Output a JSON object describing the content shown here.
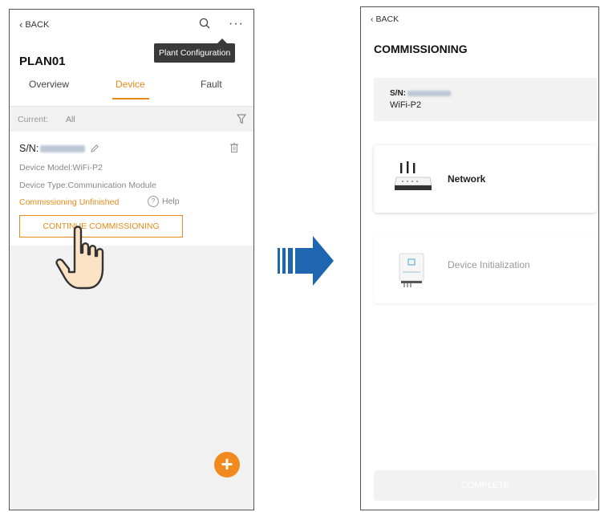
{
  "left": {
    "back_label": "BACK",
    "tooltip": "Plant Configuration",
    "plan_name": "PLAN01",
    "tabs": [
      {
        "label": "Overview"
      },
      {
        "label": "Device"
      },
      {
        "label": "Fault"
      }
    ],
    "active_tab": "Device",
    "filter": {
      "current_label": "Current:",
      "current_value": "All"
    },
    "device": {
      "sn_label": "S/N:",
      "model": "Device Model:WiFi-P2",
      "type": "Device Type:Communication Module",
      "status": "Commissioning Unfinished",
      "help_label": "Help",
      "help_glyph": "?",
      "continue_button": "CONTINUE COMMISSIONING"
    },
    "fab_glyph": "+"
  },
  "right": {
    "back_label": "BACK",
    "title": "COMMISSIONING",
    "sn_label": "S/N:",
    "device_name": "WiFi-P2",
    "options": [
      {
        "label": "Network"
      },
      {
        "label": "Device Initialization"
      }
    ],
    "complete_button": "COMPLETE"
  },
  "colors": {
    "accent": "#e88a1a",
    "fab": "#f08a1e",
    "arrow": "#1f66b0",
    "grey_background": "#f1f1f1"
  },
  "icons": [
    "chevron-left-icon",
    "search-icon",
    "more-icon",
    "filter-icon",
    "edit-icon",
    "trash-icon",
    "help-icon",
    "pointing-hand-icon",
    "plus-icon",
    "arrow-right-icon",
    "router-icon",
    "inverter-icon"
  ]
}
